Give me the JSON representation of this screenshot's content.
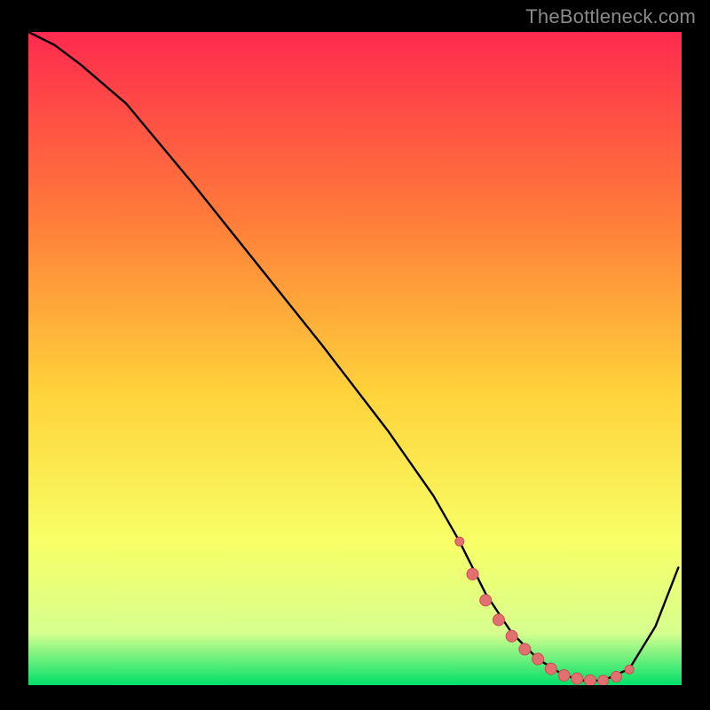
{
  "attribution": "TheBottleneck.com",
  "colors": {
    "gradient_top": "#ff2a4f",
    "gradient_mid_upper": "#ff7a3a",
    "gradient_mid": "#ffd23a",
    "gradient_mid_lower": "#f8ff66",
    "gradient_lower": "#d7ff8f",
    "gradient_bottom": "#00e06a",
    "curve": "#000000",
    "marker_fill": "#e37070",
    "marker_stroke": "#c94f4f"
  },
  "chart_data": {
    "type": "line",
    "title": "",
    "xlabel": "",
    "ylabel": "",
    "xlim": [
      0,
      100
    ],
    "ylim": [
      0,
      100
    ],
    "series": [
      {
        "name": "curve",
        "x": [
          0,
          4,
          8,
          15,
          25,
          35,
          45,
          55,
          62,
          66,
          68,
          70,
          74,
          78,
          82,
          85,
          88,
          92,
          96,
          99.5
        ],
        "y": [
          100,
          98,
          95,
          89,
          77,
          64.5,
          52,
          39,
          29,
          22,
          18,
          14,
          8,
          4,
          1.5,
          0.7,
          0.7,
          2.5,
          9,
          18
        ]
      }
    ],
    "markers": {
      "name": "highlight-points",
      "x": [
        66,
        68,
        70,
        72,
        74,
        76,
        78,
        80,
        82,
        84,
        86,
        88,
        90,
        92
      ],
      "y": [
        22,
        17,
        13,
        10,
        7.5,
        5.5,
        4,
        2.5,
        1.5,
        1,
        0.7,
        0.7,
        1.3,
        2.4
      ],
      "r": [
        5,
        6.5,
        6.5,
        6.5,
        6.5,
        6.5,
        6.5,
        6.5,
        6.5,
        6.5,
        6.5,
        6,
        6,
        5
      ]
    }
  }
}
